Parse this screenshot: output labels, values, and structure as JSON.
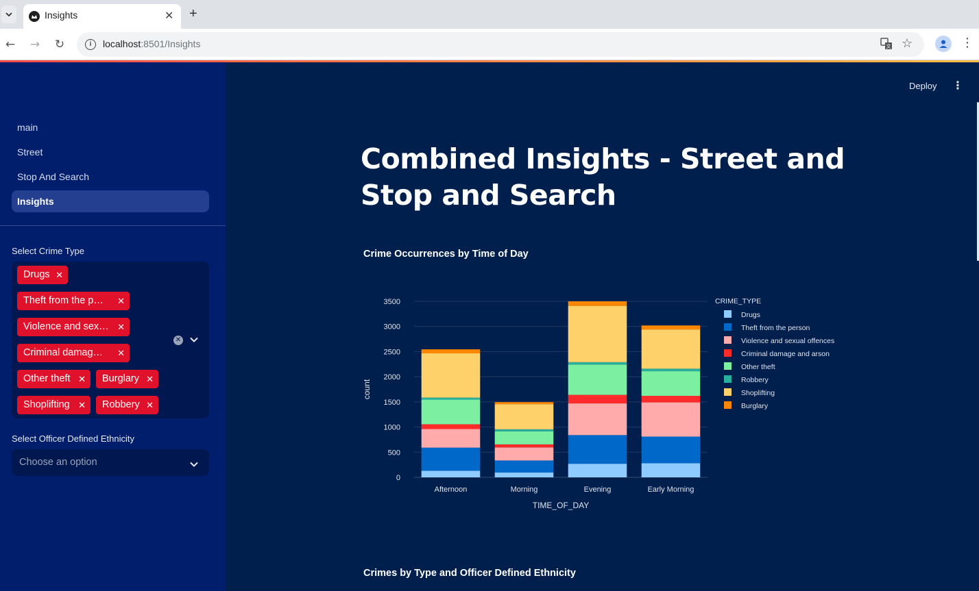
{
  "browser": {
    "tab_title": "Insights",
    "url_host": "localhost",
    "url_rest": ":8501/Insights"
  },
  "sidebar": {
    "nav": [
      {
        "label": "main"
      },
      {
        "label": "Street"
      },
      {
        "label": "Stop And Search"
      },
      {
        "label": "Insights",
        "active": true
      }
    ],
    "crime_type_label": "Select Crime Type",
    "chips": [
      {
        "label": "Drugs"
      },
      {
        "label": "Theft from the p…"
      },
      {
        "label": "Violence and sex…"
      },
      {
        "label": "Criminal damag…"
      },
      {
        "label": "Other theft"
      },
      {
        "label": "Burglary"
      },
      {
        "label": "Shoplifting"
      },
      {
        "label": "Robbery"
      }
    ],
    "ethnicity_label": "Select Officer Defined Ethnicity",
    "ethnicity_placeholder": "Choose an option"
  },
  "main": {
    "deploy_label": "Deploy",
    "page_title": "Combined Insights - Street and Stop and Search",
    "chart1_title": "Crime Occurrences by Time of Day",
    "chart2_title": "Crimes by Type and Officer Defined Ethnicity"
  },
  "colors": {
    "chip": "#e0112b",
    "sidebar_bg": "#001e6b",
    "main_bg": "#001f4d"
  },
  "chart_data": {
    "type": "bar",
    "stacked": true,
    "xlabel": "TIME_OF_DAY",
    "ylabel": "count",
    "ylim": [
      0,
      3500
    ],
    "yticks": [
      0,
      500,
      1000,
      1500,
      2000,
      2500,
      3000,
      3500
    ],
    "grid": true,
    "legend_title": "CRIME_TYPE",
    "legend_position": "right",
    "categories": [
      "Afternoon",
      "Morning",
      "Evening",
      "Early Morning"
    ],
    "series": [
      {
        "name": "Drugs",
        "color": "#8fcbff",
        "values": [
          130,
          95,
          270,
          280
        ]
      },
      {
        "name": "Theft from the person",
        "color": "#0068c9",
        "values": [
          460,
          240,
          570,
          530
        ]
      },
      {
        "name": "Violence and sexual offences",
        "color": "#ffabab",
        "values": [
          370,
          260,
          630,
          680
        ]
      },
      {
        "name": "Criminal damage and arson",
        "color": "#ff2b2b",
        "values": [
          95,
          60,
          170,
          130
        ]
      },
      {
        "name": "Other theft",
        "color": "#7defa1",
        "values": [
          490,
          260,
          600,
          490
        ]
      },
      {
        "name": "Robbery",
        "color": "#29b09d",
        "values": [
          40,
          40,
          50,
          50
        ]
      },
      {
        "name": "Shoplifting",
        "color": "#ffd16a",
        "values": [
          880,
          500,
          1120,
          780
        ]
      },
      {
        "name": "Burglary",
        "color": "#ff8700",
        "values": [
          80,
          40,
          90,
          80
        ]
      }
    ]
  }
}
